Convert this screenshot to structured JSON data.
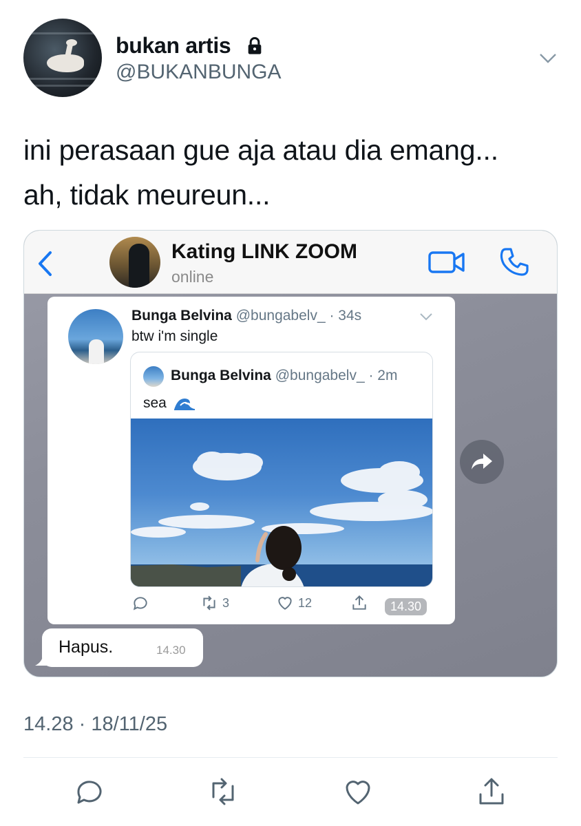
{
  "tweet": {
    "display_name": "bukan artis",
    "handle": "@BUKANBUNGA",
    "text_line1": "ini perasaan gue aja atau dia emang...",
    "text_line2": "ah, tidak meureun...",
    "timestamp": "14.28 · 18/11/25"
  },
  "chat": {
    "contact_name": "Kating LINK ZOOM",
    "contact_status": "online",
    "shared_tweet": {
      "name": "Bunga Belvina",
      "handle_time": "@bungabelv_ · 34s",
      "text": "btw i'm single",
      "quote": {
        "name": "Bunga Belvina",
        "handle_time": "@bungabelv_ · 2m",
        "text": "sea"
      },
      "retweets": "3",
      "likes": "12"
    },
    "shared_time": "14.30",
    "reply": {
      "text": "Hapus.",
      "time": "14.30"
    }
  },
  "colors": {
    "link_blue": "#1877f2",
    "secondary_text": "#536471",
    "chat_background": "#8c8e9a"
  },
  "icons": [
    "lock-icon",
    "chevron-down-icon",
    "back-icon",
    "video-call-icon",
    "phone-icon",
    "forward-icon",
    "reply-icon",
    "retweet-icon",
    "like-icon",
    "share-icon",
    "wave-emoji-icon"
  ]
}
